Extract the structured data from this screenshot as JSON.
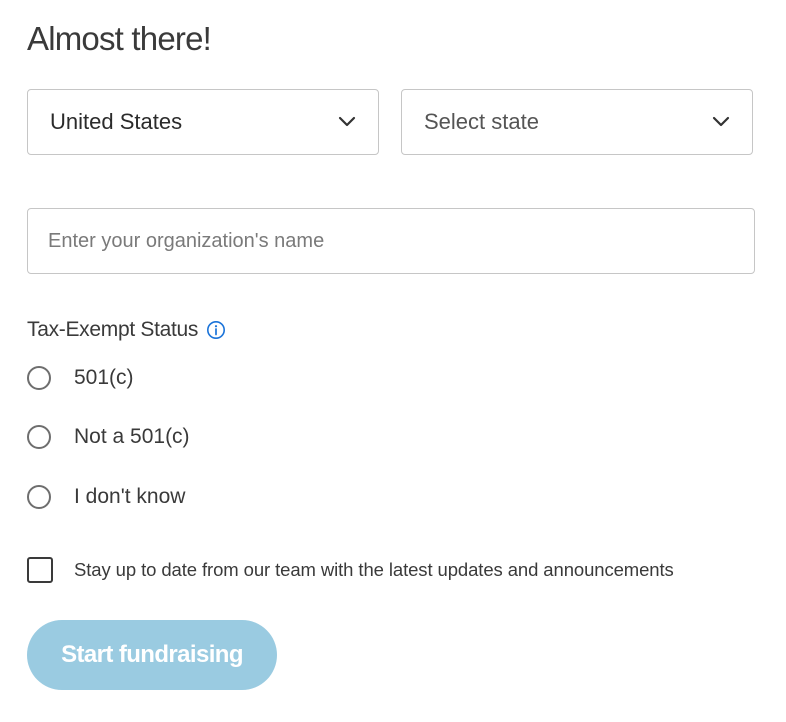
{
  "heading": "Almost there!",
  "country_select": {
    "value": "United States",
    "icon": "chevron-down-icon"
  },
  "state_select": {
    "value": "Select state",
    "icon": "chevron-down-icon"
  },
  "org_name": {
    "placeholder": "Enter your organization's name",
    "value": ""
  },
  "tax_status": {
    "label": "Tax-Exempt Status",
    "info_icon": "info-icon",
    "options": [
      {
        "label": "501(c)",
        "selected": false
      },
      {
        "label": "Not a 501(c)",
        "selected": false
      },
      {
        "label": "I don't know",
        "selected": false
      }
    ]
  },
  "newsletter": {
    "label": "Stay up to date from our team with the latest updates and announcements",
    "checked": false
  },
  "cta": {
    "label": "Start fundraising"
  },
  "colors": {
    "cta_background": "#9acbe1",
    "info_icon": "#1a73d9",
    "border": "#c6c6c6"
  }
}
